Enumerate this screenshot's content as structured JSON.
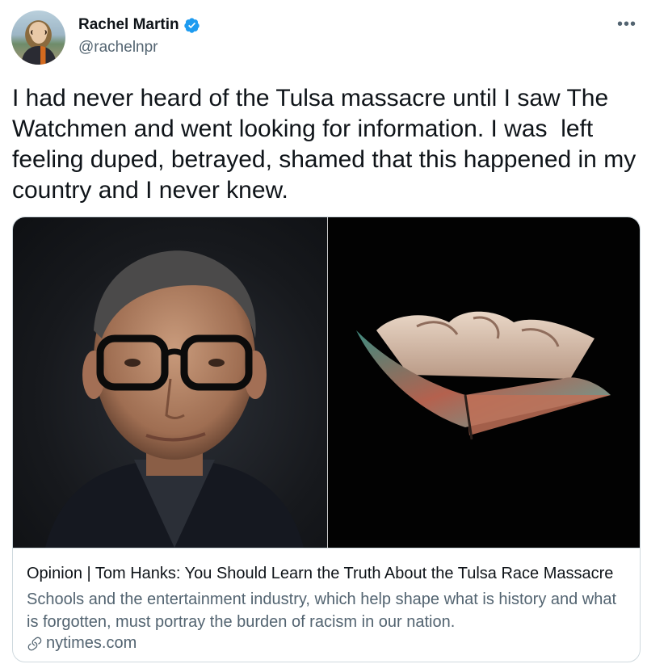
{
  "author": {
    "display_name": "Rachel Martin",
    "handle": "@rachelnpr",
    "verified": true,
    "avatar_icon": "profile-photo"
  },
  "tweet": {
    "text": "I had never heard of the Tulsa massacre until I saw The Watchmen and went looking for information. I was  left feeling duped, betrayed, shamed that this happened in my country and I never knew."
  },
  "card": {
    "title": "Opinion | Tom Hanks: You Should Learn the Truth About the Tulsa Race Massacre",
    "description": "Schools and the entertainment industry, which help shape what is history and what is forgotten, must portray the burden of racism in our nation.",
    "domain": "nytimes.com",
    "images": [
      "portrait-photo",
      "burned-book-photo"
    ]
  },
  "colors": {
    "verified_blue": "#1d9bf0",
    "secondary_text": "#536471",
    "primary_text": "#0f1419",
    "border": "#cfd9de"
  }
}
